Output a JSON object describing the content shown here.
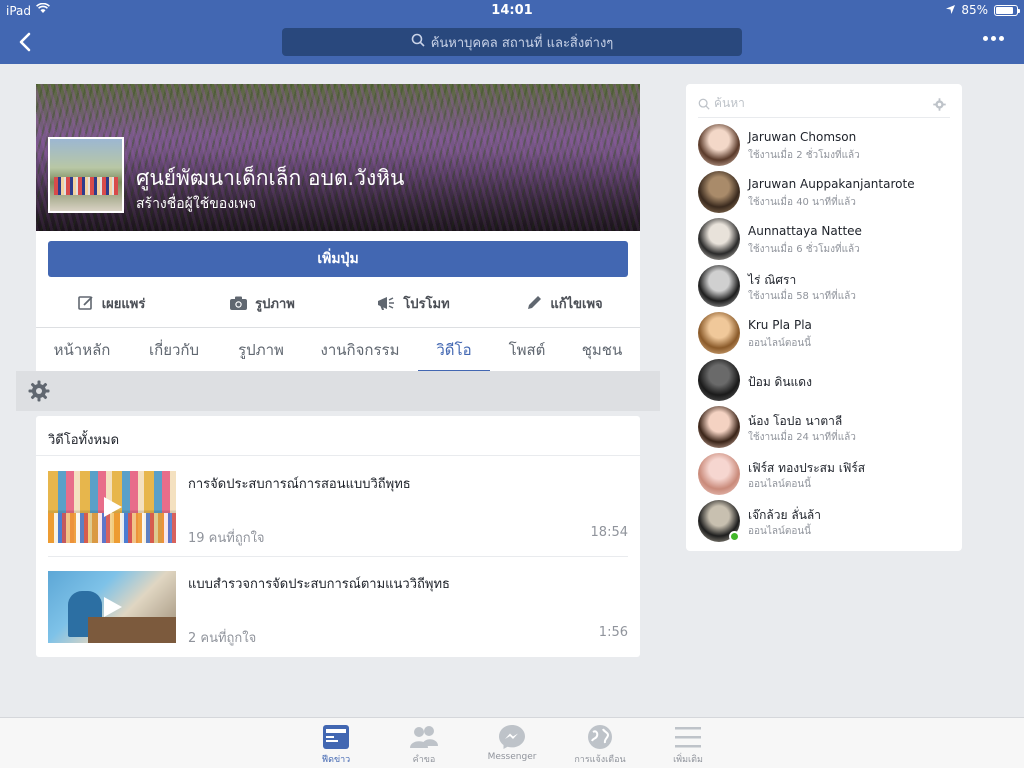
{
  "status_bar": {
    "carrier": "iPad",
    "time": "14:01",
    "battery": "85%"
  },
  "nav": {
    "search_placeholder": "ค้นหาบุคคล สถานที่ และสิ่งต่างๆ"
  },
  "page": {
    "name": "ศูนย์พัฒนาเด็กเล็ก อบต.วังหิน",
    "subtitle": "สร้างชื่อผู้ใช้ของเพจ",
    "add_button": "เพิ่มปุ่ม",
    "actions": [
      "เผยแพร่",
      "รูปภาพ",
      "โปรโมท",
      "แก้ไขเพจ"
    ],
    "tabs": [
      "หน้าหลัก",
      "เกี่ยวกับ",
      "รูปภาพ",
      "งานกิจกรรม",
      "วิดีโอ",
      "โพสต์",
      "ชุมชน"
    ],
    "active_tab": "วิดีโอ"
  },
  "videos": {
    "section_title": "วิดีโอทั้งหมด",
    "items": [
      {
        "title": "การจัดประสบการณ์การสอนแบบวิถีพุทธ",
        "likes": "19 คนที่ถูกใจ",
        "duration": "18:54"
      },
      {
        "title": "แบบสำรวจการจัดประสบการณ์ตามแนววิถีพุทธ",
        "likes": "2 คนที่ถูกใจ",
        "duration": "1:56"
      }
    ]
  },
  "friends": {
    "search_placeholder": "ค้นหา",
    "items": [
      {
        "name": "Jaruwan Chomson",
        "status": "ใช้งานเมื่อ 2 ชั่วโมงที่แล้ว",
        "avatar_colors": [
          "#f3d8c8",
          "#5a3a2a"
        ]
      },
      {
        "name": "Jaruwan Auppakanjantarote",
        "status": "ใช้งานเมื่อ 40 นาทีที่แล้ว",
        "avatar_colors": [
          "#a98b6a",
          "#3a2a1e"
        ]
      },
      {
        "name": "Aunnattaya Nattee",
        "status": "ใช้งานเมื่อ 6 ชั่วโมงที่แล้ว",
        "avatar_colors": [
          "#e8e2da",
          "#2a2a2a"
        ]
      },
      {
        "name": "ไร่ ณิศรา",
        "status": "ใช้งานเมื่อ 58 นาทีที่แล้ว",
        "avatar_colors": [
          "#d0d0d0",
          "#1e1e1e"
        ]
      },
      {
        "name": "Kru Pla Pla",
        "status": "ออนไลน์ตอนนี้",
        "avatar_colors": [
          "#f0c89a",
          "#8a5a2a"
        ]
      },
      {
        "name": "ป้อม ดินแดง",
        "status": "",
        "avatar_colors": [
          "#6a6a6a",
          "#1a1a1a"
        ]
      },
      {
        "name": "น้อง โอปอ นาตาลี",
        "status": "ใช้งานเมื่อ 24 นาทีที่แล้ว",
        "avatar_colors": [
          "#f4d2c2",
          "#3a2418"
        ]
      },
      {
        "name": "เฟิร์ส ทองประสม เฟิร์ส",
        "status": "ออนไลน์ตอนนี้",
        "avatar_colors": [
          "#f6d6d0",
          "#c98a7a"
        ]
      },
      {
        "name": "เจ๊กล้วย ลั่นล้า",
        "status": "ออนไลน์ตอนนี้",
        "avatar_colors": [
          "#c8c0b0",
          "#1e1e1e"
        ],
        "online_dot": true
      }
    ]
  },
  "bottom_tabs": [
    {
      "label": "ฟีดข่าว",
      "icon": "news-feed-icon",
      "active": true
    },
    {
      "label": "คำขอ",
      "icon": "friend-requests-icon",
      "active": false
    },
    {
      "label": "Messenger",
      "icon": "messenger-icon",
      "active": false
    },
    {
      "label": "การแจ้งเตือน",
      "icon": "globe-notifications-icon",
      "active": false
    },
    {
      "label": "เพิ่มเติม",
      "icon": "menu-icon",
      "active": false
    }
  ],
  "colors": {
    "brand_blue": "#4267b2",
    "online_green": "#42b72a"
  }
}
